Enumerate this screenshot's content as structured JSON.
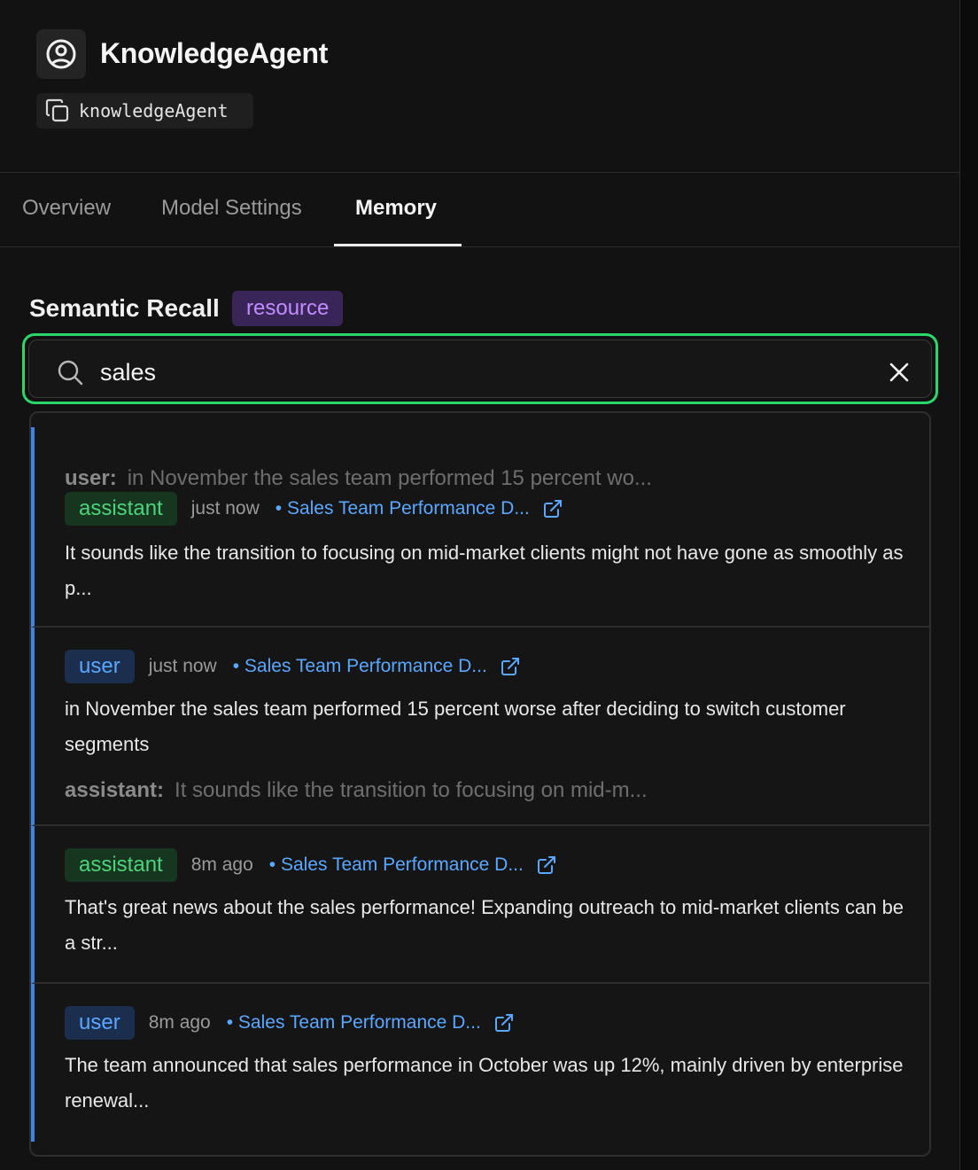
{
  "header": {
    "title": "KnowledgeAgent",
    "agent_id": "knowledgeAgent",
    "avatar_icon": "user-circle-icon",
    "copy_icon": "copy-icon"
  },
  "tabs": [
    {
      "label": "Overview",
      "active": false
    },
    {
      "label": "Model Settings",
      "active": false
    },
    {
      "label": "Memory",
      "active": true
    }
  ],
  "section": {
    "title": "Semantic Recall",
    "scope_badge": "resource"
  },
  "search": {
    "value": "sales",
    "placeholder": "",
    "icon": "search-icon",
    "clear_icon": "close-icon"
  },
  "colors": {
    "accent_green": "#2bd66a",
    "assistant_green": "#4ed27c",
    "user_blue": "#5aa7ff",
    "scope_purple": "#c18cff"
  },
  "results": [
    {
      "context_before": {
        "role": "user:",
        "text": "in November the sales team performed 15 percent wo..."
      },
      "role": "assistant",
      "time": "just now",
      "thread": "• Sales Team Performance D...",
      "message": "It sounds like the transition to focusing on mid-market clients might not have gone as smoothly as p..."
    },
    {
      "role": "user",
      "time": "just now",
      "thread": "• Sales Team Performance D...",
      "message": "in November the sales team performed 15 percent worse after deciding to switch customer segments",
      "context_after": {
        "role": "assistant:",
        "text": "It sounds like the transition to focusing on mid-m..."
      }
    },
    {
      "role": "assistant",
      "time": "8m ago",
      "thread": "• Sales Team Performance D...",
      "message": "That's great news about the sales performance! Expanding outreach to mid-market clients can be a str..."
    },
    {
      "role": "user",
      "time": "8m ago",
      "thread": "• Sales Team Performance D...",
      "message": "The team announced that sales performance in October was up 12%, mainly driven by enterprise renewal..."
    }
  ]
}
